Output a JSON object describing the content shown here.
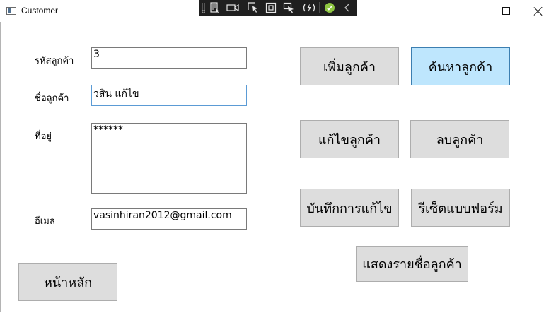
{
  "window": {
    "title": "Customer"
  },
  "debug_toolbar": {
    "icons": [
      "live-visual-tree-icon",
      "camera-icon",
      "select-element-icon",
      "display-layout-adorners-icon",
      "track-focus-icon",
      "hot-reload-icon",
      "check-icon",
      "collapse-chevron-icon"
    ]
  },
  "form": {
    "customer_id": {
      "label": "รหัสลูกค้า",
      "value": "3"
    },
    "customer_name": {
      "label": "ชื่อลูกค้า",
      "value": "วสิน แก้ไข"
    },
    "address": {
      "label": "ที่อยู่",
      "value": "******"
    },
    "email": {
      "label": "อีเมล",
      "value": "vasinhiran2012@gmail.com"
    }
  },
  "buttons": {
    "add": "เพิ่มลูกค้า",
    "search": "ค้นหาลูกค้า",
    "edit": "แก้ไขลูกค้า",
    "delete": "ลบลูกค้า",
    "save_edit": "บันทึกการแก้ไข",
    "reset": "รีเซ็ตแบบฟอร์ม",
    "list": "แสดงรายชื่อลูกค้า",
    "home": "หน้าหลัก"
  },
  "colors": {
    "button_bg": "#dddddd",
    "button_hover_bg": "#bee6fd",
    "focus_border": "#5b9bd5"
  }
}
